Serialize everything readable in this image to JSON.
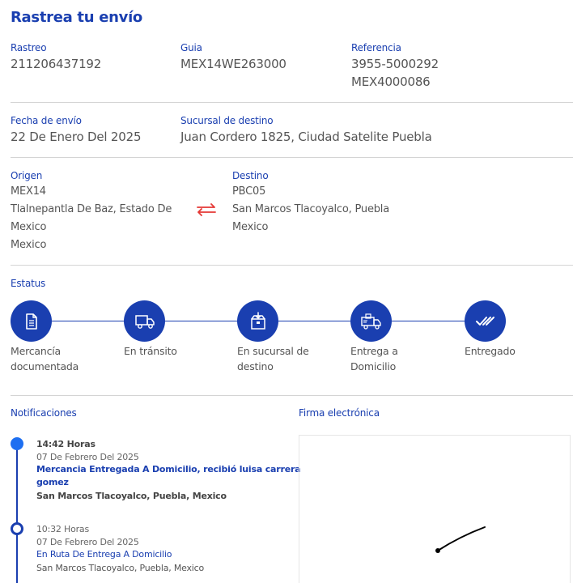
{
  "page_title": "Rastrea tu envío",
  "tracking": {
    "label": "Rastreo",
    "value": "211206437192"
  },
  "guide": {
    "label": "Guia",
    "value": "MEX14WE263000"
  },
  "reference": {
    "label": "Referencia",
    "value_line1": "3955-5000292",
    "value_line2": "MEX4000086"
  },
  "ship_date": {
    "label": "Fecha de envío",
    "value": "22 De Enero Del 2025"
  },
  "destination_branch": {
    "label": "Sucursal de destino",
    "value": "Juan Cordero 1825, Ciudad Satelite Puebla"
  },
  "origin": {
    "label": "Origen",
    "code": "MEX14",
    "city_line1": "Tlalnepantla De Baz, Estado De",
    "city_line2": "Mexico",
    "country": "Mexico"
  },
  "destination": {
    "label": "Destino",
    "code": "PBC05",
    "city": "San Marcos Tlacoyalco, Puebla",
    "country": "Mexico"
  },
  "status": {
    "label": "Estatus",
    "steps": [
      {
        "line1": "Mercancía",
        "line2": "documentada",
        "icon": "document-icon"
      },
      {
        "line1": "En tránsito",
        "line2": "",
        "icon": "truck-icon"
      },
      {
        "line1": "En sucursal de",
        "line2": "destino",
        "icon": "box-icon"
      },
      {
        "line1": "Entrega a",
        "line2": "Domicilio",
        "icon": "delivery-truck-icon"
      },
      {
        "line1": "Entregado",
        "line2": "",
        "icon": "double-check-icon"
      }
    ]
  },
  "notifications": {
    "label": "Notificaciones",
    "items": [
      {
        "time": "14:42 Horas",
        "date": "07 De Febrero Del 2025",
        "message_line1": "Mercancia Entregada A Domicilio, recibió luisa carrera",
        "message_line2": "gomez",
        "location": "San Marcos Tlacoyalco, Puebla, Mexico"
      },
      {
        "time": "10:32 Horas",
        "date": "07 De Febrero Del 2025",
        "message_line1": "En Ruta De Entrega A Domicilio",
        "location": "San Marcos Tlacoyalco, Puebla, Mexico"
      }
    ]
  },
  "signature": {
    "label": "Firma electrónica"
  },
  "colors": {
    "primary": "#1a3fb0",
    "accent_red": "#e53935",
    "dot_active": "#1e6ff1"
  }
}
